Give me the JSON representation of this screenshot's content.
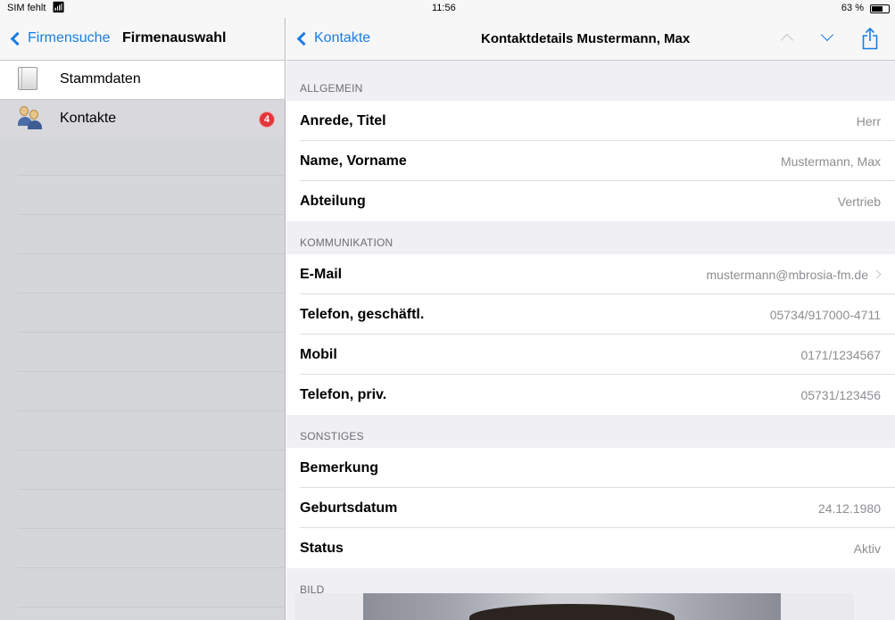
{
  "status_bar": {
    "carrier": "SIM fehlt",
    "time": "11:56",
    "battery": "63 %"
  },
  "left": {
    "back_label": "Firmensuche",
    "title": "Firmenauswahl",
    "items": [
      {
        "label": "Stammdaten",
        "icon": "document-icon"
      },
      {
        "label": "Kontakte",
        "icon": "contacts-icon",
        "badge": "4"
      }
    ]
  },
  "right": {
    "back_label": "Kontakte",
    "title": "Kontaktdetails Mustermann, Max",
    "sections": [
      {
        "header": "ALLGEMEIN",
        "rows": [
          {
            "key": "Anrede, Titel",
            "value": "Herr"
          },
          {
            "key": "Name, Vorname",
            "value": "Mustermann, Max"
          },
          {
            "key": "Abteilung",
            "value": "Vertrieb"
          }
        ]
      },
      {
        "header": "KOMMUNIKATION",
        "rows": [
          {
            "key": "E-Mail",
            "value": "mustermann@mbrosia-fm.de"
          },
          {
            "key": "Telefon, geschäftl.",
            "value": "05734/917000-4711"
          },
          {
            "key": "Mobil",
            "value": "0171/1234567"
          },
          {
            "key": "Telefon, priv.",
            "value": "05731/123456"
          }
        ]
      },
      {
        "header": "SONSTIGES",
        "rows": [
          {
            "key": "Bemerkung",
            "value": ""
          },
          {
            "key": "Geburtsdatum",
            "value": "24.12.1980"
          },
          {
            "key": "Status",
            "value": "Aktiv"
          }
        ]
      },
      {
        "header": "BILD",
        "rows": []
      }
    ]
  },
  "colors": {
    "accent": "#1a7ce2",
    "badge": "#e2353a",
    "section_bg": "#efeff4",
    "sidebar_bg": "#d5d6da"
  }
}
